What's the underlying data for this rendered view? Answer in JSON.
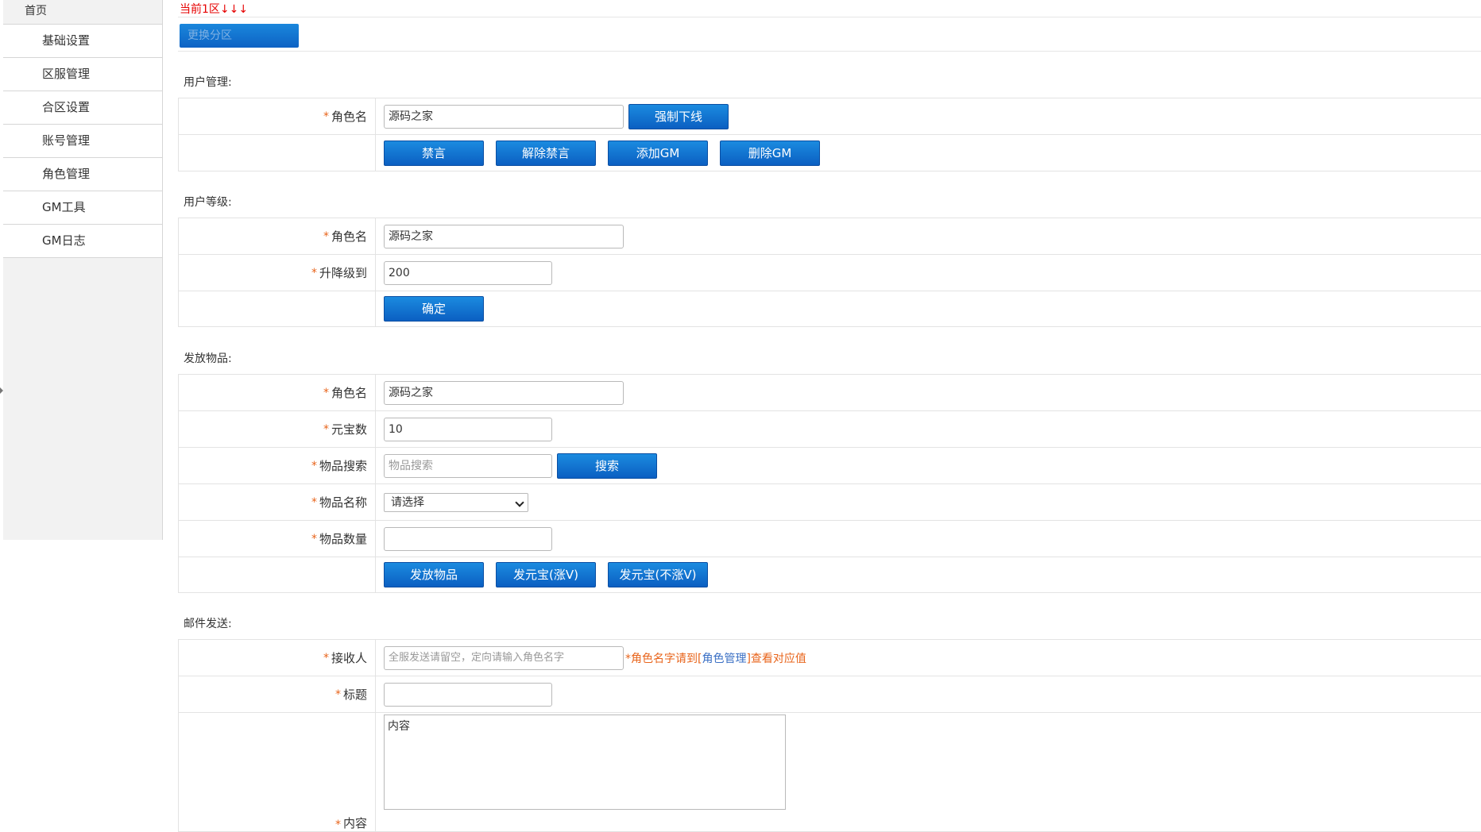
{
  "sidebar": {
    "home": "首页",
    "items": [
      "基础设置",
      "区服管理",
      "合区设置",
      "账号管理",
      "角色管理",
      "GM工具",
      "GM日志"
    ]
  },
  "header": {
    "current_zone": "当前1区↓↓↓",
    "switch_button": "更换分区"
  },
  "user_management": {
    "title": "用户管理:",
    "role_label": "角色名",
    "role_value": "源码之家",
    "force_offline": "强制下线",
    "buttons": [
      "禁言",
      "解除禁言",
      "添加GM",
      "删除GM"
    ]
  },
  "user_level": {
    "title": "用户等级:",
    "role_label": "角色名",
    "role_value": "源码之家",
    "level_label": "升降级到",
    "level_value": "200",
    "confirm": "确定"
  },
  "items": {
    "title": "发放物品:",
    "role_label": "角色名",
    "role_value": "源码之家",
    "yuanbao_label": "元宝数",
    "yuanbao_value": "10",
    "search_label": "物品搜索",
    "search_placeholder": "物品搜索",
    "search_button": "搜索",
    "name_label": "物品名称",
    "name_selected": "请选择",
    "qty_label": "物品数量",
    "qty_value": "",
    "buttons": [
      "发放物品",
      "发元宝(涨V)",
      "发元宝(不涨V)"
    ]
  },
  "mail": {
    "title": "邮件发送:",
    "receiver_label": "接收人",
    "receiver_placeholder": "全服发送请留空，定向请输入角色名字",
    "hint_prefix": "*角色名字请到[",
    "hint_link": "角色管理",
    "hint_suffix": "]查看对应值",
    "subject_label": "标题",
    "subject_value": "",
    "content_label": "内容",
    "content_value": "内容"
  },
  "required_mark": "*"
}
